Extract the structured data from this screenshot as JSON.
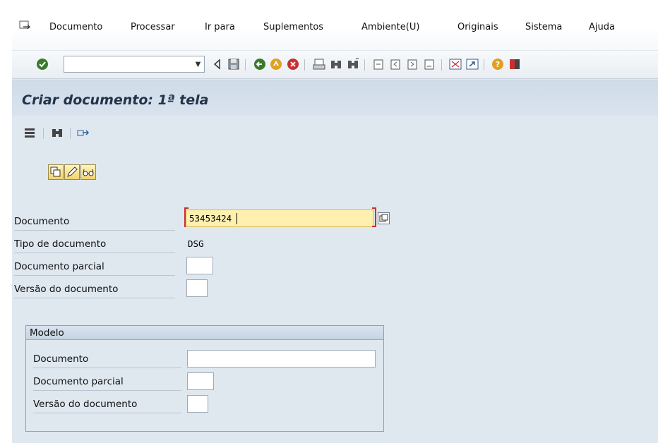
{
  "menu": {
    "items": [
      "Documento",
      "Processar",
      "Ir para",
      "Suplementos",
      "Ambiente(U)",
      "Originais",
      "Sistema",
      "Ajuda"
    ]
  },
  "toolbar": {
    "command_value": "",
    "icons": [
      "enter-icon",
      "back-arrow-icon",
      "save-icon",
      "back-icon",
      "exit-icon",
      "cancel-icon",
      "print-icon",
      "find-icon",
      "find-next-icon",
      "first-page-icon",
      "previous-page-icon",
      "next-page-icon",
      "last-page-icon",
      "create-session-icon",
      "shortcut-icon",
      "help-icon",
      "customize-layout-icon"
    ]
  },
  "page": {
    "title": "Criar documento: 1ª tela"
  },
  "app_toolbar": {
    "icons": [
      "data-icon",
      "find-icon",
      "exit-transfer-icon"
    ]
  },
  "mode_buttons": [
    "copy-icon",
    "pencil-icon",
    "glasses-icon"
  ],
  "form": {
    "documento_label": "Documento",
    "documento_value": "53453424",
    "tipo_label": "Tipo de documento",
    "tipo_value": "DSG",
    "parcial_label": "Documento parcial",
    "parcial_value": "",
    "versao_label": "Versão do documento",
    "versao_value": ""
  },
  "modelo": {
    "title": "Modelo",
    "documento_label": "Documento",
    "documento_value": "",
    "parcial_label": "Documento parcial",
    "parcial_value": "",
    "versao_label": "Versão do documento",
    "versao_value": ""
  },
  "colors": {
    "background": "#dfe7ef",
    "title_bar": "#cfdbe8",
    "active_field": "#fff0b0",
    "required_mark": "#c8302f"
  }
}
